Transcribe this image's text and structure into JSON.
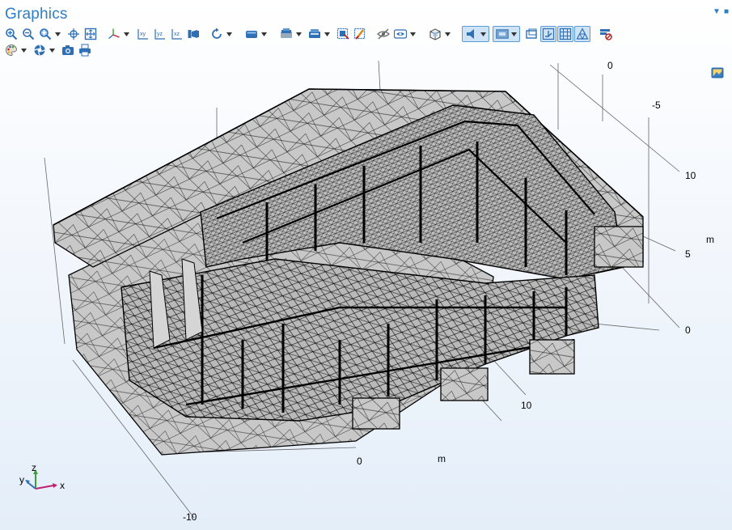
{
  "window": {
    "title": "Graphics"
  },
  "toolbar": {
    "row1": [
      {
        "name": "zoom-in-button",
        "icon": "zoom-in-icon"
      },
      {
        "name": "zoom-out-button",
        "icon": "zoom-out-icon"
      },
      {
        "name": "zoom-box-button",
        "icon": "zoom-box-icon",
        "dropdown": true
      },
      {
        "name": "zoom-selected-button",
        "icon": "zoom-selected-icon"
      },
      {
        "name": "zoom-extents-button",
        "icon": "zoom-extents-icon"
      },
      {
        "name": "views-button",
        "icon": "axes-view-icon",
        "dropdown": true
      },
      {
        "name": "xy-view-button",
        "icon": "xy-plane-icon"
      },
      {
        "name": "yz-view-button",
        "icon": "yz-plane-icon"
      },
      {
        "name": "xz-view-button",
        "icon": "xz-plane-icon"
      },
      {
        "name": "go-to-view-button",
        "icon": "camera-view-icon"
      },
      {
        "name": "reset-view-button",
        "icon": "rotate-icon",
        "dropdown": true
      },
      {
        "name": "select-objects-button",
        "icon": "select-domains-icon",
        "dropdown": true
      },
      {
        "name": "select-boundaries-button",
        "icon": "select-boundaries-icon",
        "dropdown": true
      },
      {
        "name": "selection-mode-button",
        "icon": "selection-list-icon",
        "dropdown": true
      },
      {
        "name": "select-box-button",
        "icon": "select-box-icon"
      },
      {
        "name": "clear-selection-button",
        "icon": "clear-selection-icon"
      },
      {
        "name": "hide-selected-button",
        "icon": "hide-icon"
      },
      {
        "name": "show-options-button",
        "icon": "eye-icon",
        "dropdown": true
      },
      {
        "name": "transparency-button",
        "icon": "transparency-icon",
        "dropdown": true
      },
      {
        "name": "lighting-button",
        "icon": "light-icon",
        "dropdown": true,
        "active": true
      },
      {
        "name": "wireframe-button",
        "icon": "wireframe-icon",
        "dropdown": true,
        "active": true
      },
      {
        "name": "render-mode-button",
        "icon": "render-mode-icon"
      },
      {
        "name": "axis-orientation-button",
        "icon": "axis-orientation-icon",
        "active": true
      },
      {
        "name": "grid-button",
        "icon": "grid-icon",
        "active": true
      },
      {
        "name": "mesh-button",
        "icon": "mesh-icon",
        "active": true
      },
      {
        "name": "clear-plot-button",
        "icon": "clear-plot-icon"
      }
    ],
    "row2": [
      {
        "name": "scene-light-button",
        "icon": "palette-icon",
        "dropdown": true
      },
      {
        "name": "camera-settings-button",
        "icon": "aperture-icon",
        "dropdown": true
      },
      {
        "name": "image-snapshot-button",
        "icon": "camera-icon"
      },
      {
        "name": "print-button",
        "icon": "printer-icon"
      }
    ]
  },
  "axes": {
    "x_ticks": [
      "0",
      "10"
    ],
    "x_unit": "m",
    "y_ticks": [
      "-10"
    ],
    "z_ticks": [
      "0",
      "-5",
      "10",
      "5",
      "0"
    ],
    "z_unit": "m"
  },
  "triad": {
    "x": "x",
    "y": "y",
    "z": "z"
  },
  "colors": {
    "accent": "#2e7ec6",
    "mesh_fill": "#c8c8c8",
    "mesh_edge": "#000000",
    "grid": "#666666"
  }
}
